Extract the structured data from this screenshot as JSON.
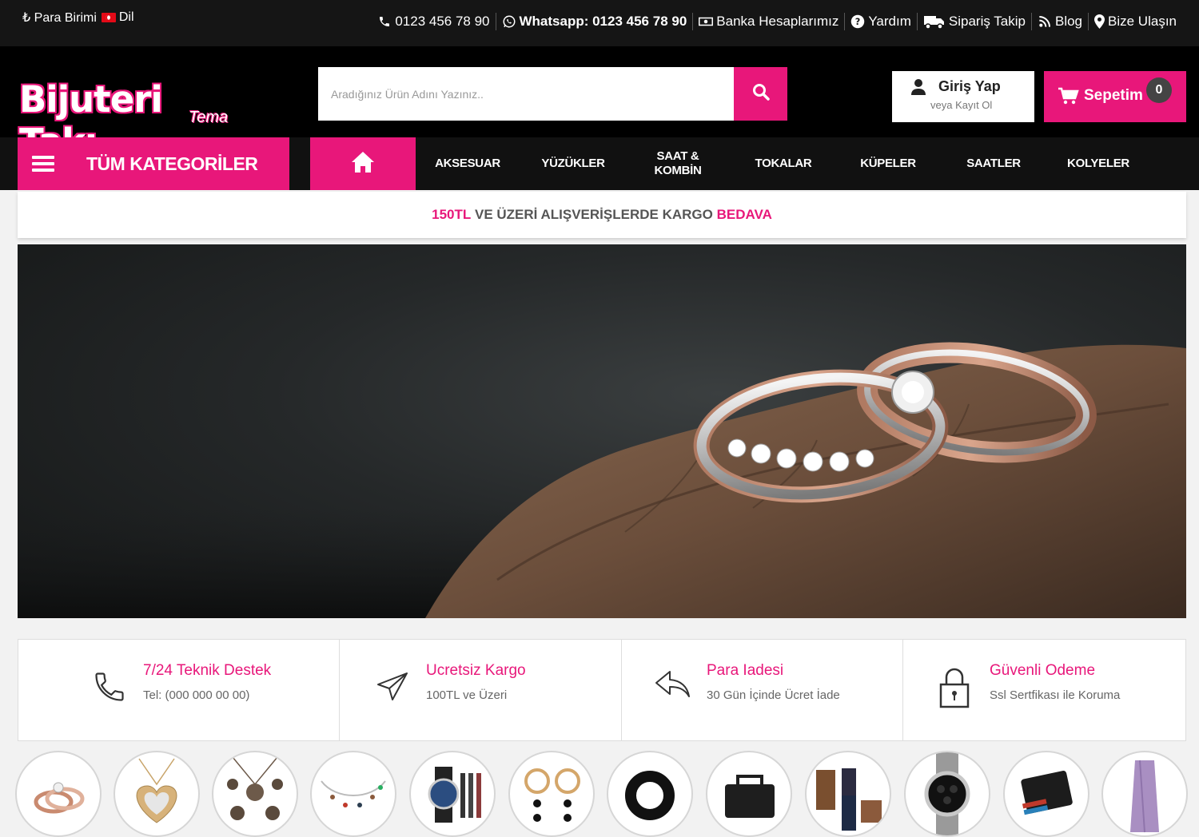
{
  "topbar": {
    "currency_label": "Para Birimi",
    "currency_symbol": "₺",
    "language_label": "Dil",
    "links": [
      {
        "icon": "phone-icon",
        "label": "0123 456 78 90"
      },
      {
        "icon": "whatsapp-icon",
        "label": "Whatsapp: 0123 456 78 90"
      },
      {
        "icon": "money-icon",
        "label": "Banka Hesaplarımız"
      },
      {
        "icon": "question-icon",
        "label": "Yardım"
      },
      {
        "icon": "truck-icon",
        "label": "Sipariş Takip"
      },
      {
        "icon": "rss-icon",
        "label": "Blog"
      },
      {
        "icon": "map-marker-icon",
        "label": "Bize Ulaşın"
      }
    ]
  },
  "header": {
    "logo_main": "Bijuteri Takı",
    "logo_sub": "Tema",
    "search_placeholder": "Aradığınız Ürün Adını Yazınız..",
    "login_title": "Giriş Yap",
    "login_subtitle": "veya Kayıt Ol",
    "cart_label": "Sepetim",
    "cart_count": "0"
  },
  "nav": {
    "all_categories": "TÜM KATEGORİLER",
    "items": [
      "AKSESUAR",
      "YÜZÜKLER",
      "SAAT & KOMBİN",
      "TOKALAR",
      "KÜPELER",
      "SAATLER",
      "KOLYELER"
    ]
  },
  "promo": {
    "amount": "150TL",
    "text": "VE ÜZERİ ALIŞVERİŞLERDE KARGO",
    "highlight": "BEDAVA"
  },
  "features": [
    {
      "icon": "phone-icon",
      "title": "7/24 Teknik Destek",
      "subtitle": "Tel: (000 000 00 00)"
    },
    {
      "icon": "paper-plane-icon",
      "title": "Ucretsiz Kargo",
      "subtitle": "100TL ve Üzeri"
    },
    {
      "icon": "reply-arrow-icon",
      "title": "Para Iadesi",
      "subtitle": "30 Gün İçinde Ücret İade"
    },
    {
      "icon": "lock-icon",
      "title": "Güvenli Odeme",
      "subtitle": "Ssl Sertfikası ile Koruma"
    }
  ],
  "categories": [
    {
      "icon": "rings-icon"
    },
    {
      "icon": "heart-necklace-icon"
    },
    {
      "icon": "jewelry-set-icon"
    },
    {
      "icon": "bracelet-icon"
    },
    {
      "icon": "watch-set-icon"
    },
    {
      "icon": "earrings-icon"
    },
    {
      "icon": "scrunchie-icon"
    },
    {
      "icon": "bag-icon"
    },
    {
      "icon": "outfit-icon"
    },
    {
      "icon": "chrono-watch-icon"
    },
    {
      "icon": "wallet-icon"
    },
    {
      "icon": "scarf-icon"
    }
  ],
  "colors": {
    "accent": "#e8177a",
    "topbar": "#151515",
    "header": "#000000",
    "nav": "#111111"
  }
}
